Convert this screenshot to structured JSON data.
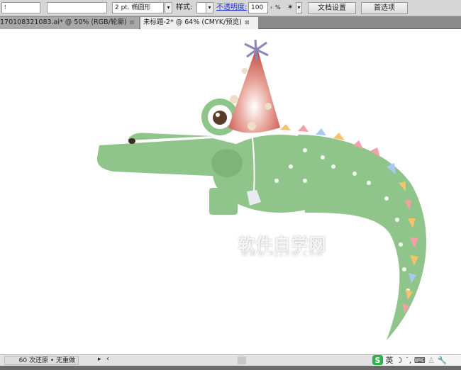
{
  "toolbar": {
    "stroke_weight": "2 pt. 椭圆形",
    "style_label": "样式:",
    "opacity_label": "不透明度:",
    "opacity_value": "100",
    "percent": "%",
    "doc_settings": "文档设置",
    "preferences": "首选项"
  },
  "tabs": [
    {
      "label": "170108321083.ai* @ 50% (RGB/轮廓)"
    },
    {
      "label": "未标题-2* @ 64% (CMYK/预览)"
    }
  ],
  "watermark": {
    "title": "软件自学网",
    "url": "WWW.RJZXW.COM"
  },
  "status": {
    "undo_text": "60 次还原 • 无重做",
    "ime_label": "英"
  }
}
